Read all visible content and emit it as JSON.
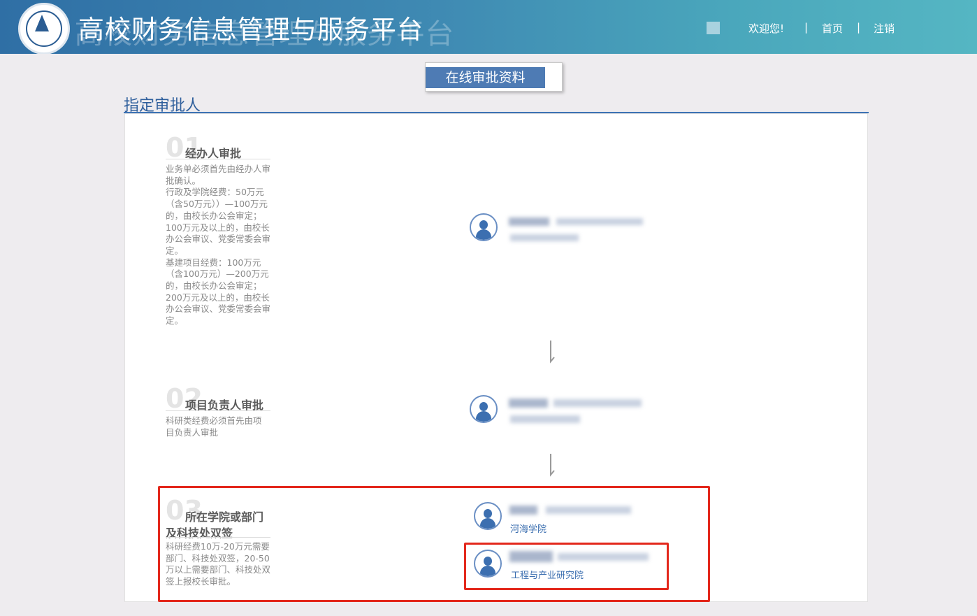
{
  "header": {
    "title": "高校财务信息管理与服务平台",
    "title_shadow": "高校财务信息管理与服务平台",
    "welcome": "欢迎您!",
    "separator": "|",
    "home": "首页",
    "logout": "注销"
  },
  "tab": {
    "label": "在线审批资料"
  },
  "section": {
    "title": "指定审批人"
  },
  "steps": [
    {
      "num": "01",
      "title": "经办人审批",
      "desc": "业务单必须首先由经办人审批确认。\n行政及学院经费：50万元（含50万元））—100万元的，由校长办公会审定；100万元及以上的，由校长办公会审议、党委常委会审定。\n基建项目经费：100万元（含100万元）—200万元的，由校长办公会审定；200万元及以上的，由校长办公会审议、党委常委会审定。"
    },
    {
      "num": "02",
      "title": "项目负责人审批",
      "desc": "科研类经费必须首先由项目负责人审批"
    },
    {
      "num": "03",
      "title_line1": "所在学院或部门",
      "title_line2": "及科技处双签",
      "desc": "科研经费10万-20万元需要部门、科技处双签，20-50万以上需要部门、科技处双签上报校长审批。"
    }
  ],
  "approvers": {
    "step3_dept_1": "河海学院",
    "step3_dept_2": "工程与产业研究院"
  },
  "colors": {
    "header_gradient_start": "#2f6fa5",
    "header_gradient_end": "#55b6c3",
    "accent_blue": "#3d73b4",
    "highlight_red": "#e3281c"
  },
  "icons": [
    "university-logo-icon",
    "user-avatar-icon",
    "down-arrow-icon"
  ]
}
